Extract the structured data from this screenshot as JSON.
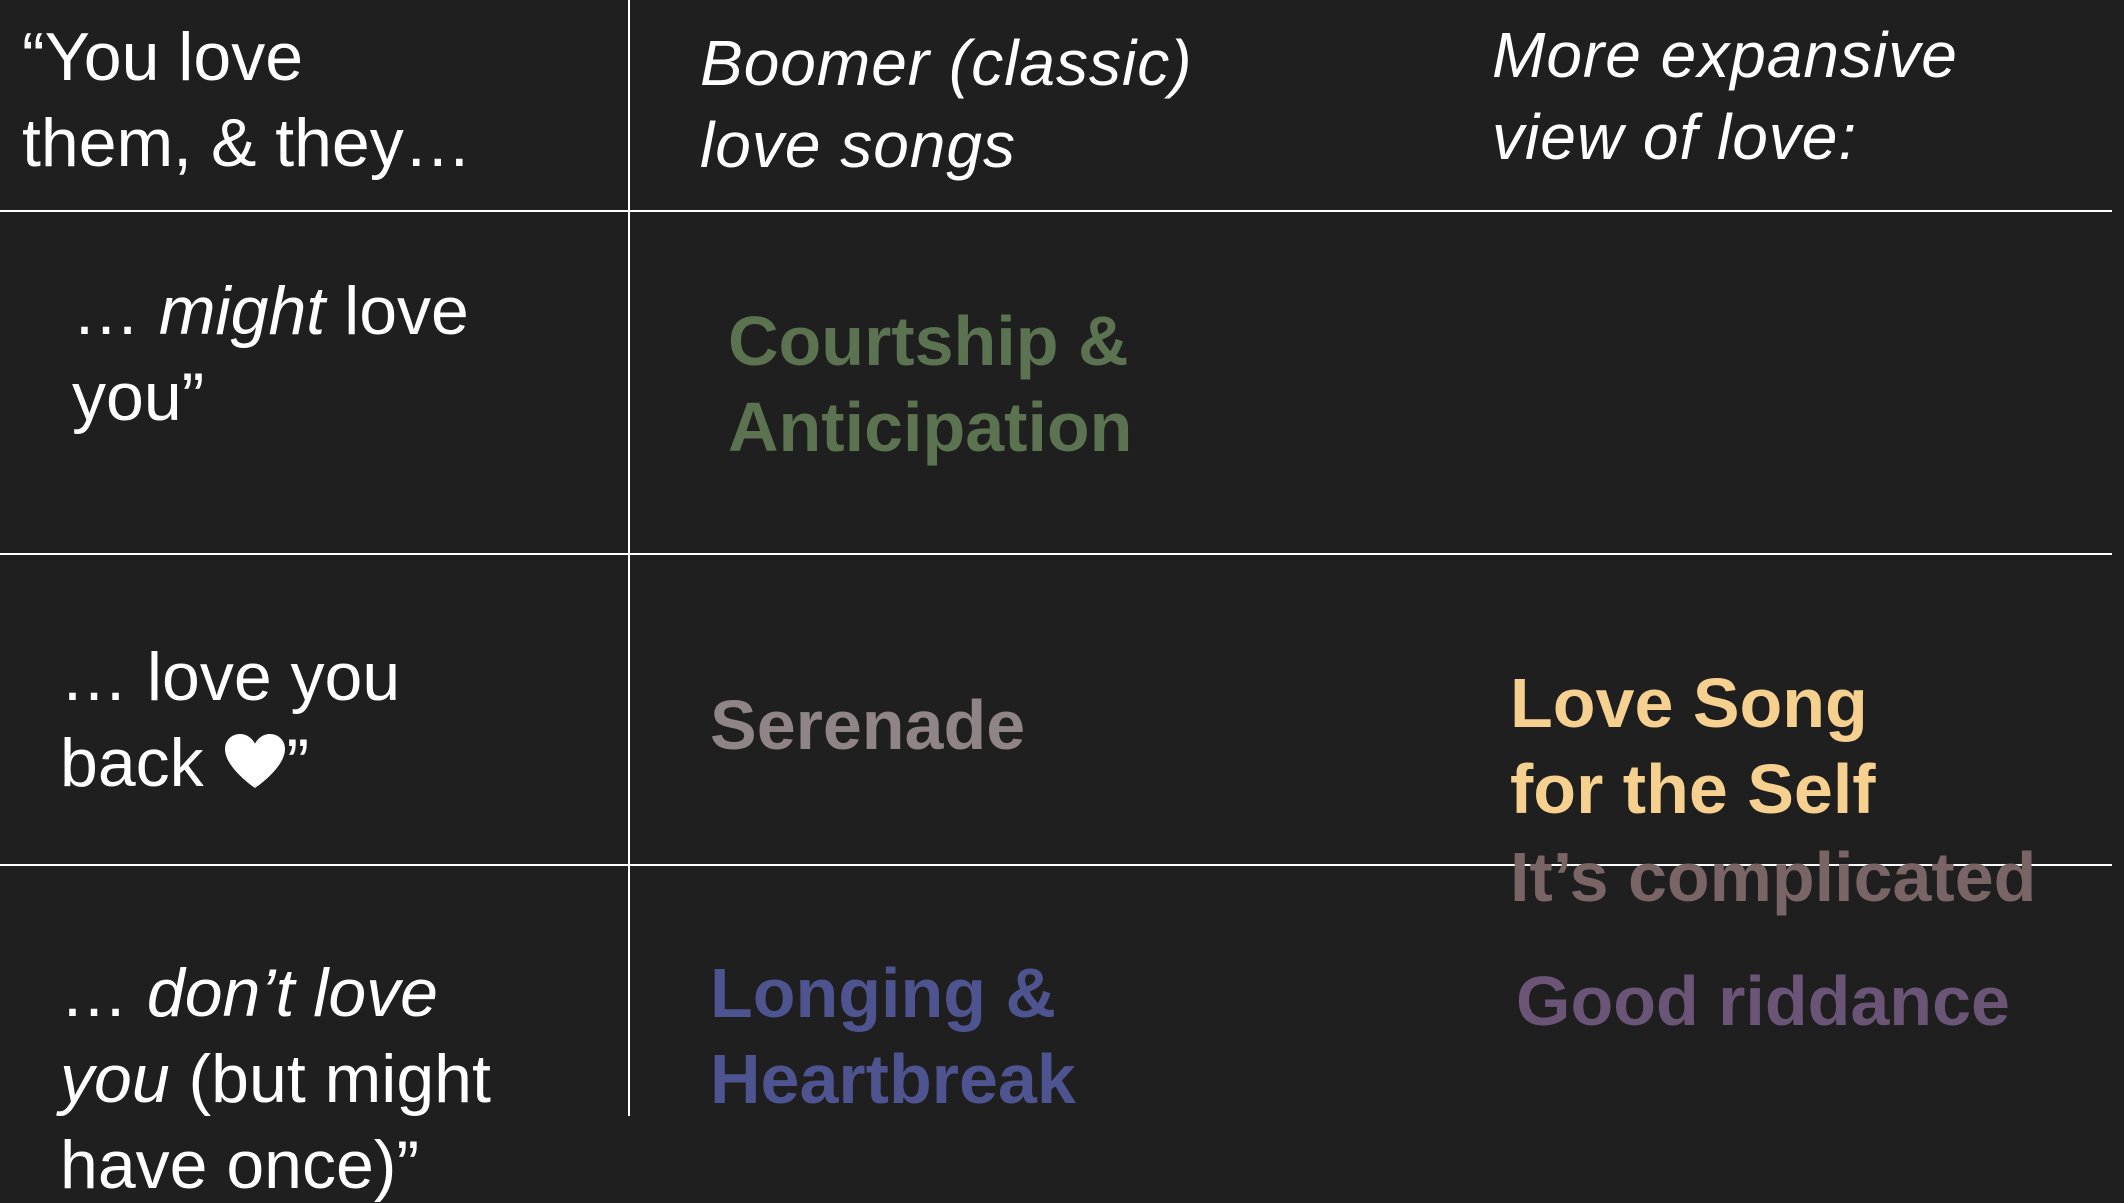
{
  "row_header_title": {
    "line1": "“You love",
    "line2": "them, & they…"
  },
  "columns": [
    {
      "line1": "Boomer (classic)",
      "line2": "love songs"
    },
    {
      "line1": "More expansive",
      "line2": "view of love:"
    }
  ],
  "rows": [
    {
      "line1_prefix": "… ",
      "line1_emph": "might",
      "line1_suffix": " love",
      "line2": "you”"
    },
    {
      "line1": "… love you",
      "line2_prefix": "back ",
      "line2_icon": "heart-icon",
      "line2_suffix": "”"
    },
    {
      "line1_prefix": "… ",
      "line1_emph": "don’t love",
      "line2_emph": "you",
      "line2_suffix": " (but might",
      "line3": "have once)”"
    }
  ],
  "categories": {
    "courtship": {
      "line1": "Courtship &",
      "line2": "Anticipation",
      "color": "#5b7350"
    },
    "serenade": {
      "label": "Serenade",
      "color": "#8f8586"
    },
    "longing": {
      "line1": "Longing &",
      "line2": "Heartbreak",
      "color": "#4e5490"
    },
    "self_love": {
      "line1": "Love Song",
      "line2": "for the Self",
      "color": "#f6d08f"
    },
    "complicated": {
      "label": "It’s complicated",
      "color": "#7a6566"
    },
    "riddance": {
      "label": "Good riddance",
      "color": "#6a5577"
    }
  }
}
